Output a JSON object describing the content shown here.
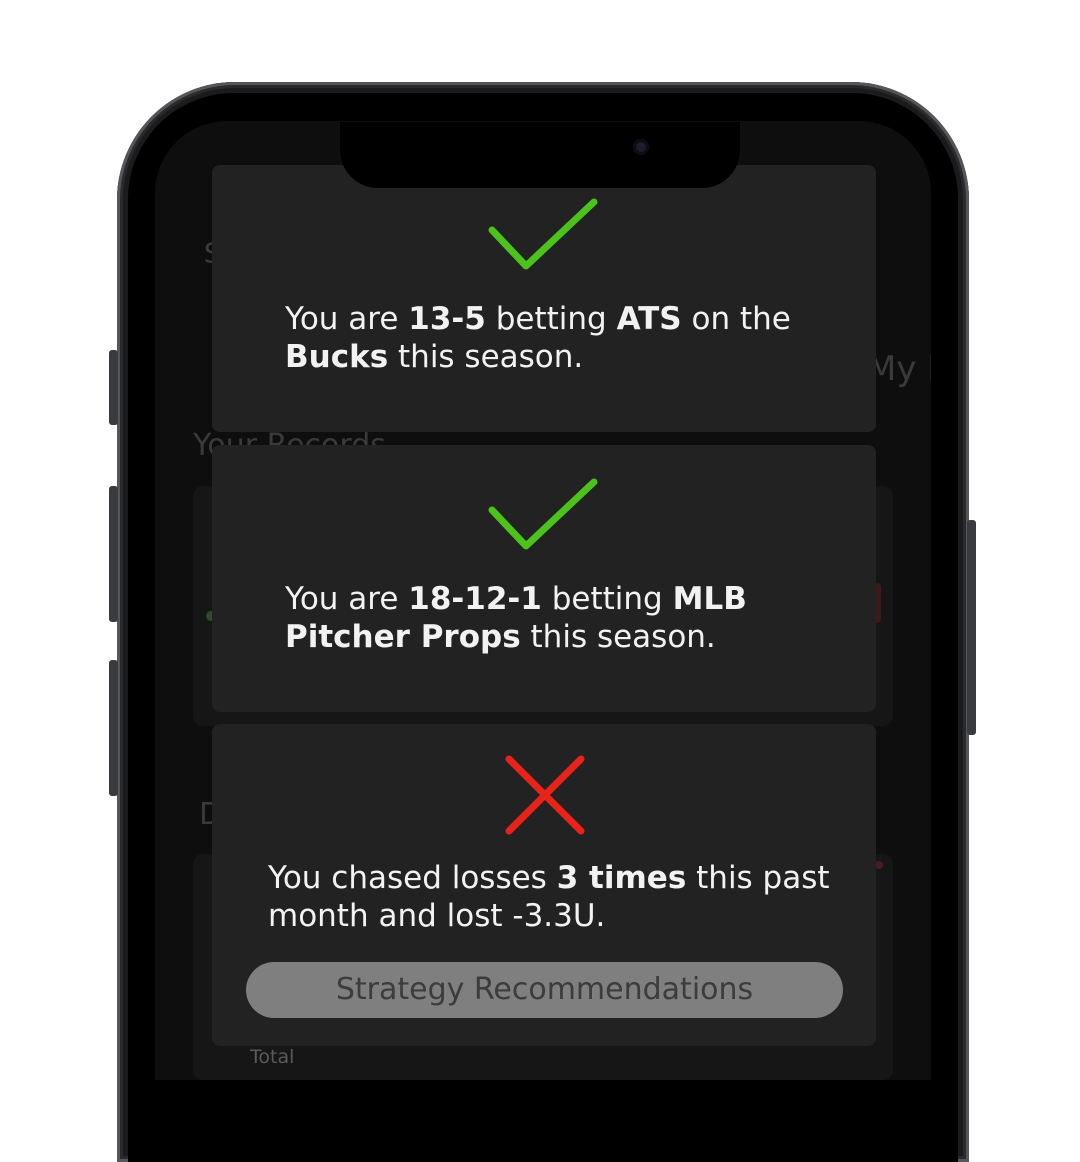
{
  "background_app": {
    "dollar_glyph": "$",
    "my_tab_fragment": "My F",
    "records_heading": "Your Records",
    "section_initial": "D",
    "total_label": "Total"
  },
  "insights": [
    {
      "status": "success",
      "icon": "check-icon",
      "icon_color": "#4cc31a",
      "segments": [
        {
          "t": "You are ",
          "b": false
        },
        {
          "t": "13-5",
          "b": true
        },
        {
          "t": " betting ",
          "b": false
        },
        {
          "t": "ATS",
          "b": true
        },
        {
          "t": " on the ",
          "b": false
        },
        {
          "t": "Bucks",
          "b": true
        },
        {
          "t": " this season.",
          "b": false
        }
      ]
    },
    {
      "status": "success",
      "icon": "check-icon",
      "icon_color": "#4cc31a",
      "segments": [
        {
          "t": "You are ",
          "b": false
        },
        {
          "t": "18-12-1",
          "b": true
        },
        {
          "t": " betting ",
          "b": false
        },
        {
          "t": "MLB Pitcher Props",
          "b": true
        },
        {
          "t": " this season.",
          "b": false
        }
      ]
    },
    {
      "status": "warning",
      "icon": "x-icon",
      "icon_color": "#e8231a",
      "segments": [
        {
          "t": "You chased losses ",
          "b": false
        },
        {
          "t": "3 times",
          "b": true
        },
        {
          "t": " this past month and lost -3.3U.",
          "b": false
        }
      ],
      "button_label": "Strategy Recommendations"
    }
  ]
}
